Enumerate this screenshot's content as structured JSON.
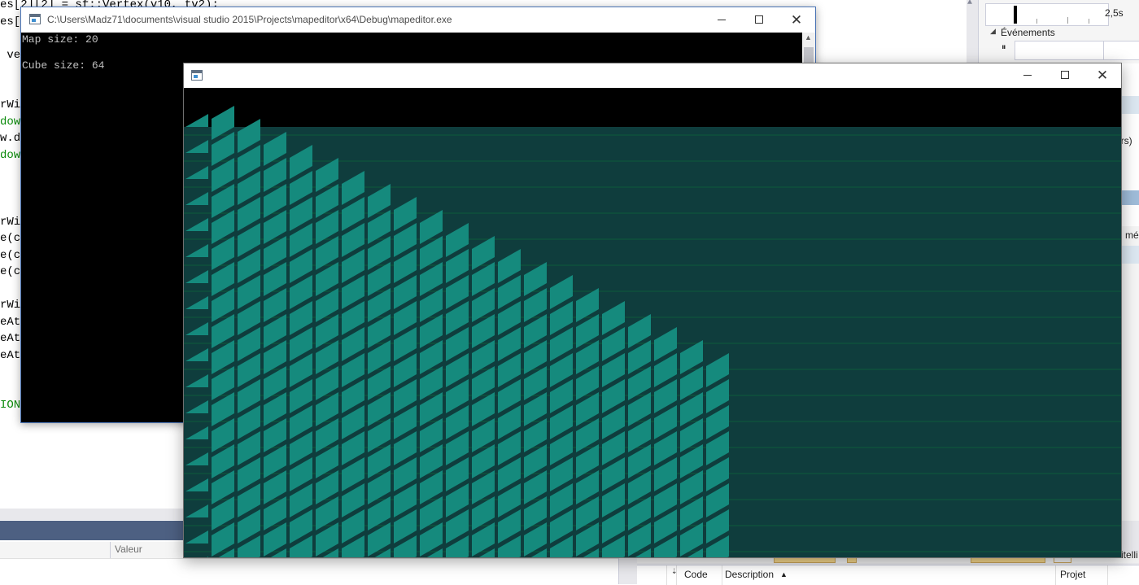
{
  "editor": {
    "code_lines": [
      {
        "text": "es[2][2] = sf::Vertex(v10, tv2);",
        "color": "#000000"
      },
      {
        "text": "es[2",
        "color": "#000000"
      },
      {
        "text": "",
        "color": "#000000"
      },
      {
        "text": " ver",
        "color": "#000000"
      },
      {
        "text": "",
        "color": "#000000"
      },
      {
        "text": "",
        "color": "#000000"
      },
      {
        "text": "rWin",
        "color": "#000000"
      },
      {
        "text": "dow.",
        "color": "#0a8a0a"
      },
      {
        "text": "w.dr",
        "color": "#000000"
      },
      {
        "text": "dow.",
        "color": "#0a8a0a"
      },
      {
        "text": "",
        "color": "#000000"
      },
      {
        "text": "",
        "color": "#000000"
      },
      {
        "text": "",
        "color": "#000000"
      },
      {
        "text": "rWin",
        "color": "#000000"
      },
      {
        "text": "e(cu",
        "color": "#000000"
      },
      {
        "text": "e(cu",
        "color": "#000000"
      },
      {
        "text": "e(cu",
        "color": "#000000"
      },
      {
        "text": "",
        "color": "#000000"
      },
      {
        "text": "rWin",
        "color": "#000000"
      },
      {
        "text": "eAt(",
        "color": "#000000"
      },
      {
        "text": "eAt(",
        "color": "#000000"
      },
      {
        "text": "eAt(",
        "color": "#000000"
      },
      {
        "text": "",
        "color": "#000000"
      },
      {
        "text": "",
        "color": "#000000"
      },
      {
        "text": "ION-",
        "color": "#0a8a0a"
      }
    ]
  },
  "watch_panel": {
    "value_column": "Valeur"
  },
  "diagnostics": {
    "time_label": "2,5s",
    "events_label": "Événements",
    "pause_icon": "⏸",
    "collapse_icon": "◢",
    "clip_text_1": "urs)",
    "clip_text_2": "mé"
  },
  "error_list": {
    "columns": [
      "Code",
      "Description",
      "Projet"
    ],
    "sort_icon": "▲",
    "toolbar_clip": "itelli"
  },
  "console_window": {
    "title": "C:\\Users\\Madz71\\documents\\visual studio 2015\\Projects\\mapeditor\\x64\\Debug\\mapeditor.exe",
    "lines": [
      "Map size: 20",
      "",
      "Cube size: 64"
    ],
    "minimize_icon": "minimize-icon",
    "maximize_icon": "maximize-icon",
    "close_glyph": "✕"
  },
  "game_window": {
    "title": "",
    "close_glyph": "✕",
    "colors": {
      "background": "#000000",
      "floor": "#0f3d3d",
      "tile": "#158a7d",
      "tile_dark": "#0f3d3d",
      "scanline": "#0c5a3a"
    }
  }
}
